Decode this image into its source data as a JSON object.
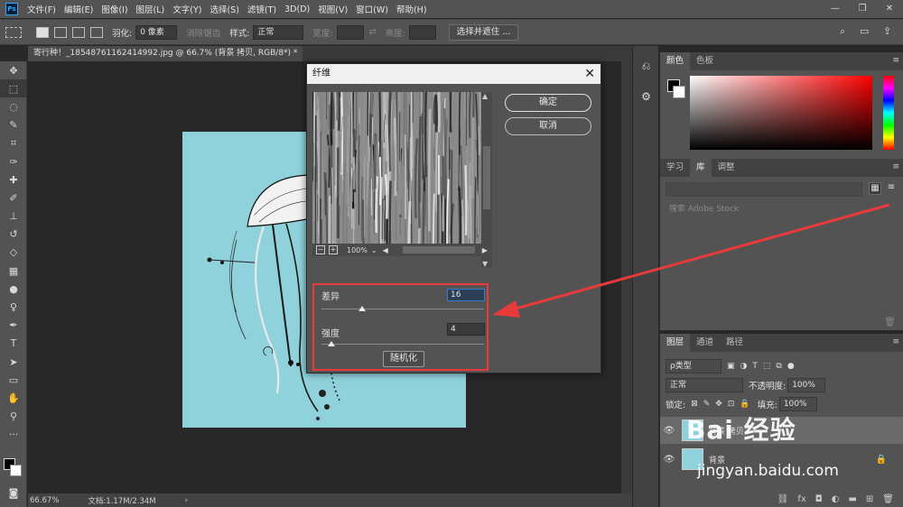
{
  "menubar": {
    "logo": "Ps",
    "items": [
      "文件(F)",
      "编辑(E)",
      "图像(I)",
      "图层(L)",
      "文字(Y)",
      "选择(S)",
      "滤镜(T)",
      "3D(D)",
      "视图(V)",
      "窗口(W)",
      "帮助(H)"
    ],
    "window_controls": [
      "—",
      "❐",
      "✕"
    ]
  },
  "options": {
    "feather_label": "羽化:",
    "feather_value": "0 像素",
    "antialias_label": "消除锯齿",
    "style_label": "样式:",
    "style_value": "正常",
    "width_label": "宽度:",
    "height_label": "高度:",
    "select_mask_button": "选择并遮住 ..."
  },
  "document": {
    "tab_title": "寄行种！_1854876116241499​2.jpg @ 66.7% (背景 拷贝, RGB/8*) *",
    "zoom": "66.67%",
    "doc_size": "文档:1.17M/2.34M"
  },
  "dialog": {
    "title": "纤维",
    "ok": "确定",
    "cancel": "取消",
    "preview_zoom": "100%",
    "variance_label": "差异",
    "variance_value": "16",
    "variance_max": 64,
    "strength_label": "强度",
    "strength_value": "4",
    "strength_max": 64,
    "randomize": "随机化"
  },
  "panels": {
    "color_tabs": [
      "颜色",
      "色板"
    ],
    "library_tabs": [
      "学习",
      "库",
      "调整"
    ],
    "library_search_placeholder": "搜索 Adobe Stock",
    "layers_tabs": [
      "图层",
      "通道",
      "路径"
    ],
    "kind_label": "ρ类型",
    "blend_mode": "正常",
    "opacity_label": "不透明度:",
    "opacity_value": "100%",
    "lock_label": "锁定:",
    "fill_label": "填充:",
    "fill_value": "100%",
    "layers": [
      {
        "name": "背景 拷贝",
        "selected": true
      },
      {
        "name": "背景",
        "selected": false
      }
    ]
  },
  "watermark": {
    "brand": "Bai 经验",
    "url": "jingyan.baidu.com"
  },
  "colors": {
    "highlight": "#e83a3a",
    "canvas_bg": "#8fd2dc"
  }
}
